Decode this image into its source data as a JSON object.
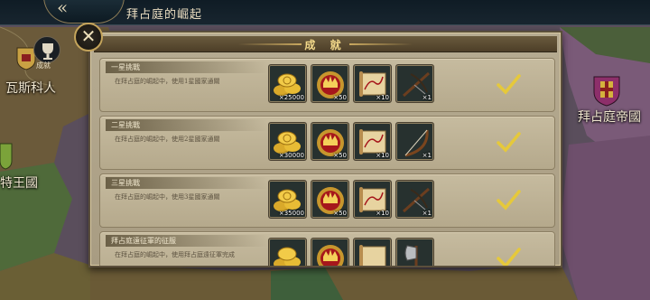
{
  "topbar": {
    "title": "拜占庭的崛起"
  },
  "map": {
    "labels": {
      "wasi": "瓦斯科人",
      "byzantine": "拜占庭帝國",
      "left": "特王國"
    },
    "cup_label": "成就"
  },
  "dialog": {
    "title": "成 就",
    "rows": [
      {
        "title": "一星挑戰",
        "desc": "在拜占庭的崛起中，使用1星國家通關",
        "items": [
          {
            "icon": "gold-coins-icon",
            "qty": "×25000"
          },
          {
            "icon": "crown-medal-icon",
            "qty": "×50"
          },
          {
            "icon": "map-scroll-icon",
            "qty": "×10"
          },
          {
            "icon": "crossbow-icon",
            "qty": "×1"
          }
        ],
        "completed": true
      },
      {
        "title": "二星挑戰",
        "desc": "在拜占庭的崛起中，使用2星國家通關",
        "items": [
          {
            "icon": "gold-coins-icon",
            "qty": "×30000"
          },
          {
            "icon": "crown-medal-icon",
            "qty": "×50"
          },
          {
            "icon": "map-scroll-icon",
            "qty": "×10"
          },
          {
            "icon": "bow-icon",
            "qty": "×1"
          }
        ],
        "completed": true
      },
      {
        "title": "三星挑戰",
        "desc": "在拜占庭的崛起中，使用3星國家通關",
        "items": [
          {
            "icon": "gold-coins-icon",
            "qty": "×35000"
          },
          {
            "icon": "crown-medal-icon",
            "qty": "×50"
          },
          {
            "icon": "map-scroll-icon",
            "qty": "×10"
          },
          {
            "icon": "crossbow-icon",
            "qty": "×1"
          }
        ],
        "completed": true
      },
      {
        "title": "拜占庭遠征軍的征服",
        "desc": "在拜占庭的崛起中，使用拜占庭遠征軍完成",
        "items": [
          {
            "icon": "gold-coins-icon",
            "qty": ""
          },
          {
            "icon": "crown-medal-icon",
            "qty": ""
          },
          {
            "icon": "map-scroll-icon",
            "qty": ""
          },
          {
            "icon": "axe-icon",
            "qty": ""
          }
        ],
        "completed": true
      }
    ]
  },
  "colors": {
    "check": "#e6c93a",
    "panel": "#b3a78b",
    "header": "#5a4a30",
    "title_gold": "#f3d98a"
  }
}
